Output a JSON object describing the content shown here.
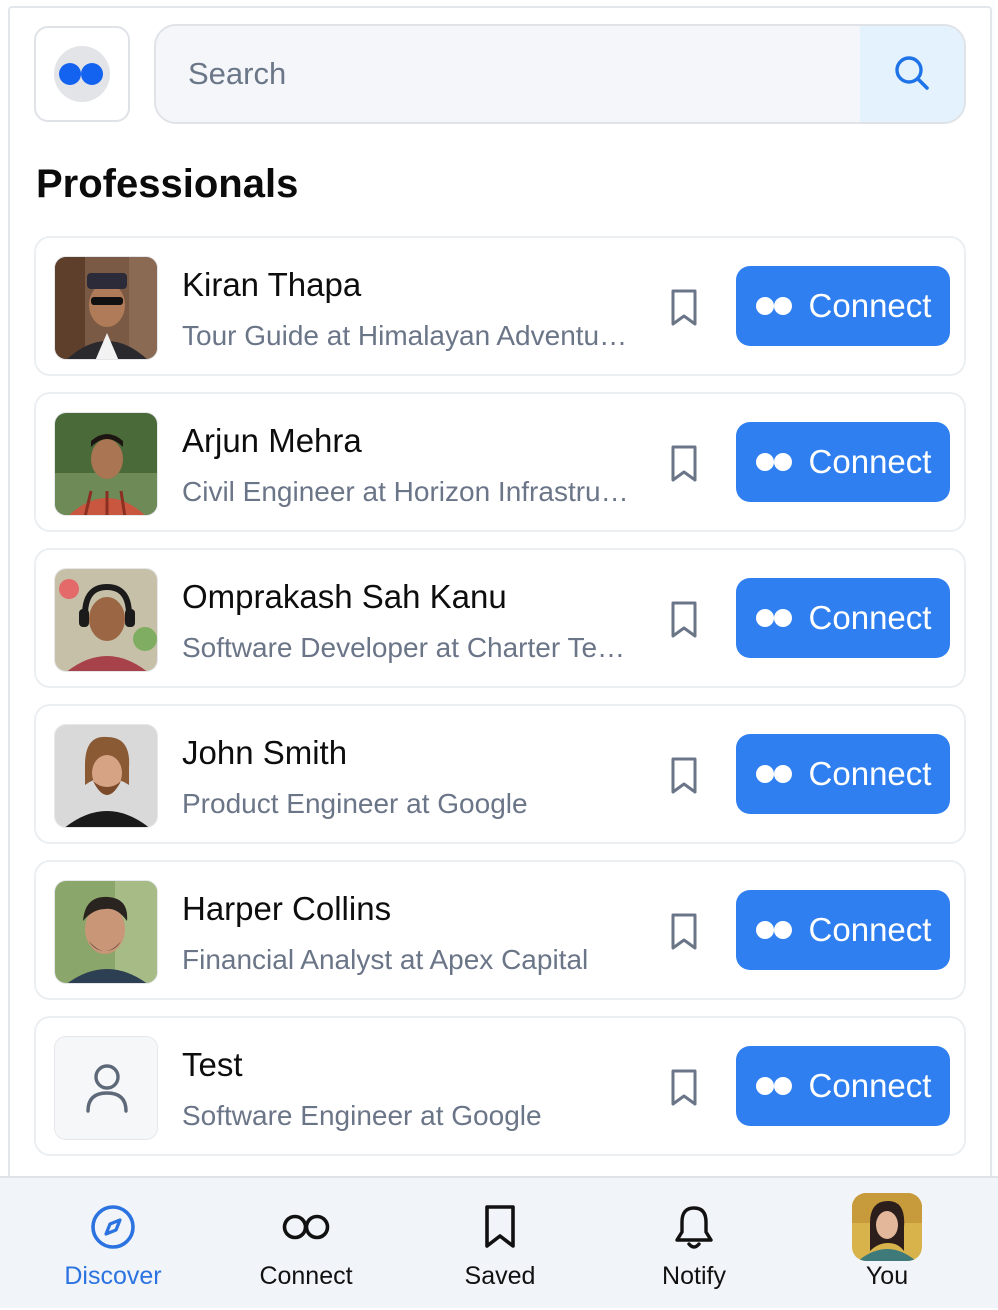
{
  "header": {
    "search": {
      "placeholder": "Search",
      "value": ""
    }
  },
  "section_title": "Professionals",
  "professionals": [
    {
      "name": "Kiran Thapa",
      "role": "Tour Guide at Himalayan Adventures",
      "connect_label": "Connect"
    },
    {
      "name": "Arjun Mehra",
      "role": "Civil Engineer at Horizon Infrastructure",
      "connect_label": "Connect"
    },
    {
      "name": "Omprakash Sah Kanu",
      "role": "Software Developer at Charter Technologies",
      "connect_label": "Connect"
    },
    {
      "name": "John Smith",
      "role": "Product Engineer at Google",
      "connect_label": "Connect"
    },
    {
      "name": "Harper Collins",
      "role": "Financial Analyst at Apex Capital",
      "connect_label": "Connect"
    },
    {
      "name": "Test",
      "role": "Software Engineer at Google",
      "connect_label": "Connect"
    }
  ],
  "bottom_nav": {
    "items": [
      {
        "label": "Discover",
        "icon": "compass-icon",
        "active": true
      },
      {
        "label": "Connect",
        "icon": "infinity-icon",
        "active": false
      },
      {
        "label": "Saved",
        "icon": "bookmark-icon",
        "active": false
      },
      {
        "label": "Notify",
        "icon": "bell-icon",
        "active": false
      },
      {
        "label": "You",
        "icon": "profile-avatar",
        "active": false
      }
    ]
  },
  "colors": {
    "accent": "#2f7ff1",
    "active_nav": "#2b73e0",
    "search_button_bg": "#e3f2fd",
    "muted_text": "#6b7588"
  }
}
